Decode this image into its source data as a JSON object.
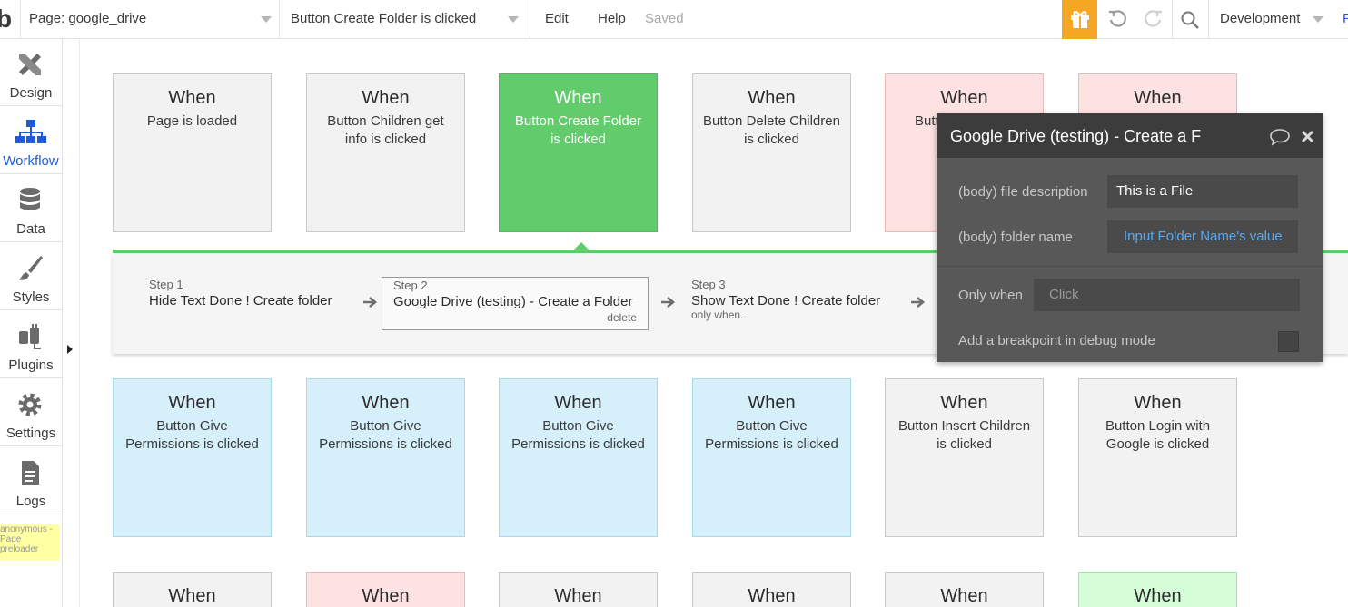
{
  "topbar": {
    "logo": "b",
    "page_selector": "Page: google_drive",
    "event_selector": "Button Create Folder is clicked",
    "edit_label": "Edit",
    "help_label": "Help",
    "saved_label": "Saved",
    "environment": "Development",
    "edge_text": "P"
  },
  "sidebar": {
    "items": [
      {
        "label": "Design",
        "icon": "design-icon"
      },
      {
        "label": "Workflow",
        "icon": "workflow-icon"
      },
      {
        "label": "Data",
        "icon": "database-icon"
      },
      {
        "label": "Styles",
        "icon": "brush-icon"
      },
      {
        "label": "Plugins",
        "icon": "plug-icon"
      },
      {
        "label": "Settings",
        "icon": "gear-icon"
      },
      {
        "label": "Logs",
        "icon": "document-icon"
      }
    ],
    "active_index": 1,
    "preloader_text": "anonymous - Page preloader"
  },
  "events": {
    "row1": [
      {
        "when": "When",
        "event": "Page is loaded"
      },
      {
        "when": "When",
        "event": "Button Children get info is clicked"
      },
      {
        "when": "When",
        "event": "Button Create Folder is clicked"
      },
      {
        "when": "When",
        "event": "Button Delete Children is clicked"
      },
      {
        "when": "When",
        "event": "Butt"
      },
      {
        "when": "When",
        "event": ""
      }
    ],
    "row2": [
      {
        "when": "When",
        "event": "Button Give Permissions is clicked"
      },
      {
        "when": "When",
        "event": "Button Give Permissions is clicked"
      },
      {
        "when": "When",
        "event": "Button Give Permissions is clicked"
      },
      {
        "when": "When",
        "event": "Button Give Permissions is clicked"
      },
      {
        "when": "When",
        "event": "Button Insert Children is clicked"
      },
      {
        "when": "When",
        "event": "Button Login with Google is clicked"
      }
    ],
    "row3": [
      {
        "when": "When"
      },
      {
        "when": "When"
      },
      {
        "when": "When"
      },
      {
        "when": "When"
      },
      {
        "when": "When"
      },
      {
        "when": "When"
      }
    ]
  },
  "steps": [
    {
      "num": "Step 1",
      "title": "Hide Text Done ! Create folder",
      "sub": ""
    },
    {
      "num": "Step 2",
      "title": "Google Drive (testing) - Create a Folder",
      "sub": "delete"
    },
    {
      "num": "Step 3",
      "title": "Show Text Done ! Create folder",
      "sub": "only when..."
    }
  ],
  "property_editor": {
    "title": "Google Drive (testing) - Create a F",
    "fields": [
      {
        "label": "(body) file description",
        "value": "This is a File"
      },
      {
        "label": "(body) folder name",
        "value": "Input Folder Name's value"
      }
    ],
    "only_when_label": "Only when",
    "only_when_placeholder": "Click",
    "breakpoint_label": "Add a breakpoint in debug mode",
    "colors": {
      "dynamic_value": "#5aa9f5",
      "header": "#3c3c3c",
      "body": "#585858"
    }
  },
  "colors": {
    "selected_event": "#62cc6c",
    "gift_button": "#f5a623",
    "active_nav": "#1f5bd4"
  }
}
